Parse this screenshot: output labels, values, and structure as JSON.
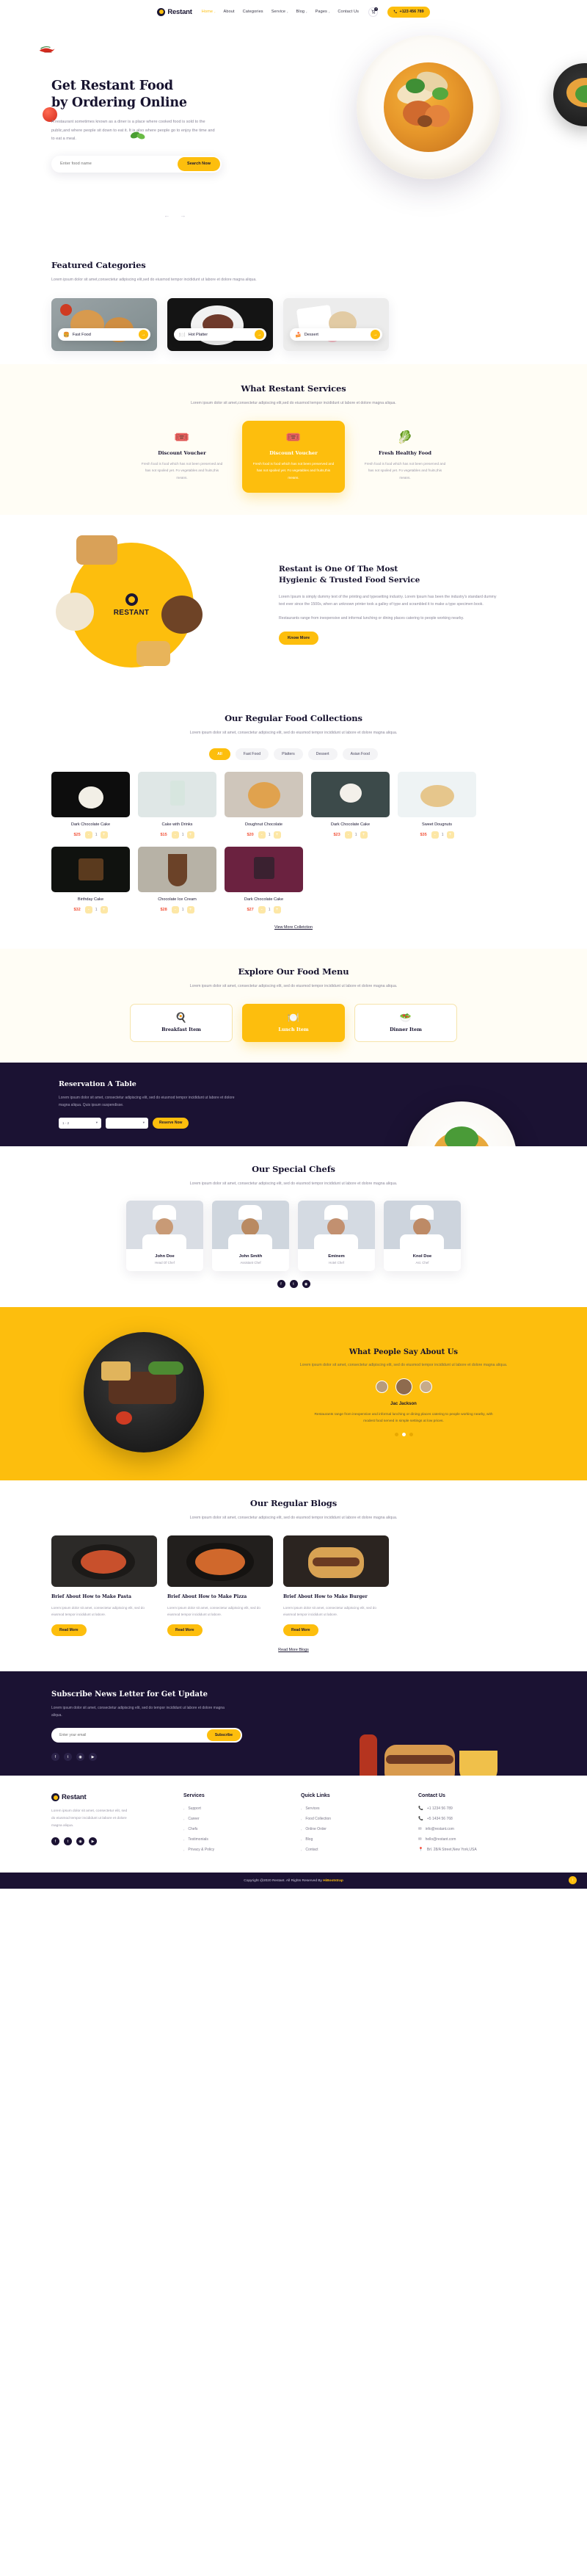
{
  "brand": {
    "name": "Restant",
    "logo_icon": "circle-logo-icon"
  },
  "header": {
    "nav": [
      {
        "label": "Home",
        "caret": "›",
        "active": true
      },
      {
        "label": "About",
        "caret": "",
        "active": false
      },
      {
        "label": "Categories",
        "caret": "",
        "active": false
      },
      {
        "label": "Service",
        "caret": "›",
        "active": false
      },
      {
        "label": "Blog",
        "caret": "›",
        "active": false
      },
      {
        "label": "Pages",
        "caret": "›",
        "active": false
      },
      {
        "label": "Contact Us",
        "caret": "",
        "active": false
      }
    ],
    "cart_icon": "shopping-cart-icon",
    "cart_count": "0",
    "phone_icon": "phone-icon",
    "phone": "+123 456 789"
  },
  "hero": {
    "title_line1": "Get Restant Food",
    "title_line2": "by Ordering Online",
    "paragraph": "A restaurant sometimes known as a diner is a place where cooked food is sold to the public,and where people sit down to eat it. It is also where people go to enjoy the time and to eat a meal.",
    "search_placeholder": "Enter food name",
    "search_button": "Search Now",
    "prev_icon": "arrow-left-icon",
    "next_icon": "arrow-right-icon"
  },
  "featured": {
    "title": "Featured Categories",
    "subtitle": "Lorem ipsum dolor sit amet,consectetur adipiscing elit,sed do eiusmod tempor incididunt ut labore et dolore magna aliqua.",
    "cards": [
      {
        "name": "Fast Food",
        "icon": "burger-icon",
        "go_icon": "arrow-right-icon"
      },
      {
        "name": "Hot Platter",
        "icon": "platter-icon",
        "go_icon": "arrow-right-icon"
      },
      {
        "name": "Dessert",
        "icon": "dessert-icon",
        "go_icon": "arrow-right-icon"
      }
    ]
  },
  "services": {
    "title": "What Restant Services",
    "subtitle": "Lorem ipsum dolor sit amet,consectetur adipiscing elit,sed do eiusmod tempor incididunt ut labore et dolore magna aliqua.",
    "cards": [
      {
        "icon": "voucher-icon",
        "title": "Discount Voucher",
        "text": "Fresh food is food which has not been preserved and has not spoiled yet. Fo vegetables and fruits,this means.",
        "active": false
      },
      {
        "icon": "voucher-icon",
        "title": "Discount Voucher",
        "text": "Fresh food is food which has not been preserved and has not spoiled yet. Fo vegetables and fruits,this means.",
        "active": true
      },
      {
        "icon": "vegetables-icon",
        "title": "Fresh Healthy Food",
        "text": "Fresh food is food which has not been preserved and has not spoiled yet. Fo vegetables and fruits,this means.",
        "active": false
      }
    ]
  },
  "hygienic": {
    "disc_label": "RESTANT",
    "title_line1": "Restant is One Of The Most",
    "title_line2": "Hygienic & Trusted Food Service",
    "paragraph1": "Lorem Ipsum is simply dummy text of the printing and typesetting industry. Lorem Ipsum has been the industry's standard dummy text ever since the 1500s, when an unknown printer took a galley of type and scrambled it to make a type specimen book.",
    "paragraph2": "Restaurants range from inexpensive and informal lunching or dining places catering to people working nearby.",
    "button": "Know More"
  },
  "collections": {
    "title": "Our Regular Food Collections",
    "subtitle": "Lorem ipsum dolor sit amet, consectetur adipiscing elit, sed do eiusmod tempor incididunt ut labore et dolore magna aliqua.",
    "tabs": [
      {
        "label": "All",
        "active": true
      },
      {
        "label": "Fast Food",
        "active": false
      },
      {
        "label": "Platters",
        "active": false
      },
      {
        "label": "Dessert",
        "active": false
      },
      {
        "label": "Asian Food",
        "active": false
      }
    ],
    "products": [
      {
        "name": "Dark Chocolate Cake",
        "price": "$25",
        "qty": "1",
        "minus": "-",
        "plus": "+"
      },
      {
        "name": "Cake with Drinks",
        "price": "$15",
        "qty": "1",
        "minus": "-",
        "plus": "+"
      },
      {
        "name": "Doughnut Chocolate",
        "price": "$20",
        "qty": "1",
        "minus": "-",
        "plus": "+"
      },
      {
        "name": "Dark Chocolate Cake",
        "price": "$23",
        "qty": "1",
        "minus": "-",
        "plus": "+"
      },
      {
        "name": "Sweet Dougnuts",
        "price": "$35",
        "qty": "1",
        "minus": "-",
        "plus": "+"
      },
      {
        "name": "Birthday Cake",
        "price": "$32",
        "qty": "1",
        "minus": "-",
        "plus": "+"
      },
      {
        "name": "Chocolate Ice Cream",
        "price": "$28",
        "qty": "1",
        "minus": "-",
        "plus": "+"
      },
      {
        "name": "Dark Chocolate Cake",
        "price": "$27",
        "qty": "1",
        "minus": "-",
        "plus": "+"
      }
    ],
    "view_more": "View More Colletction"
  },
  "foodmenu": {
    "title": "Explore Our Food Menu",
    "subtitle": "Lorem ipsum dolor sit amet, consectetur adipiscing elit, sed do eiusmod tempor incididunt ut labore et dolore magna aliqua.",
    "cards": [
      {
        "icon": "breakfast-icon",
        "label": "Breakfast Item",
        "active": false
      },
      {
        "icon": "lunch-icon",
        "label": "Lunch Item",
        "active": true
      },
      {
        "icon": "dinner-icon",
        "label": "Dinner Item",
        "active": false
      }
    ]
  },
  "reservation": {
    "title": "Reservation A Table",
    "paragraph": "Lorem ipsum dolor sit amet, consectetur adipiscing elit, sed do eiusmod tempor incididunt ut labore et dolore magna aliqua. Quis ipsum suspendisse.",
    "select_people": "1 - 2",
    "select_date": "",
    "button": "Reserve Now"
  },
  "chefs": {
    "title": "Our Special Chefs",
    "subtitle": "Lorem ipsum dolor sit amet, consectetur adipiscing elit, sed do eiusmod tempor incididunt ut labore et dolore magna aliqua.",
    "list": [
      {
        "name": "John Doe",
        "role": "Head Of Chef"
      },
      {
        "name": "John Smith",
        "role": "Assistant Chef"
      },
      {
        "name": "Eminem",
        "role": "Hotel Chef"
      },
      {
        "name": "Knol Doe",
        "role": "Ast. Chef"
      }
    ],
    "social": [
      {
        "icon": "facebook-icon"
      },
      {
        "icon": "twitter-icon"
      },
      {
        "icon": "instagram-icon"
      }
    ]
  },
  "testimonial": {
    "title": "What People Say About Us",
    "subtitle": "Lorem ipsum dolor sit amet, consectetur adipiscing elit, sed do eiusmod tempor incididunt ut labore et dolore magna aliqua.",
    "name": "Jac Jackson",
    "quote": "Restaurants range from inexpensive and informal lunching or dining places catering to people working nearby, with modest food served in simple settings at low prices."
  },
  "blogs": {
    "title": "Our Regular Blogs",
    "subtitle": "Lorem ipsum dolor sit amet, consectetur adipiscing elit, sed do eiusmod tempor incididunt ut labore et dolore magna aliqua.",
    "posts": [
      {
        "title": "Brief About How to Make Pasta",
        "text": "Lorem ipsum dolor sit amet, consectetur adipiscing elit, sed do eiusmod tempor incididunt ut labore.",
        "button": "Read More"
      },
      {
        "title": "Brief About How to Make Pizza",
        "text": "Lorem ipsum dolor sit amet, consectetur adipiscing elit, sed do eiusmod tempor incididunt ut labore.",
        "button": "Read More"
      },
      {
        "title": "Brief About How to Make Burger",
        "text": "Lorem ipsum dolor sit amet, consectetur adipiscing elit, sed do eiusmod tempor incididunt ut labore.",
        "button": "Read More"
      }
    ],
    "read_more": "Read More Blogs"
  },
  "newsletter": {
    "title": "Subscribe News Letter for Get Update",
    "paragraph": "Lorem ipsum dolor sit amet, consectetur adipiscing elit, sed do tempor incididunt ut labore et dolore magna aliqua.",
    "placeholder": "Enter your email",
    "button": "Subscribe",
    "social": [
      {
        "icon": "facebook-icon"
      },
      {
        "icon": "twitter-icon"
      },
      {
        "icon": "instagram-icon"
      },
      {
        "icon": "youtube-icon"
      }
    ]
  },
  "footer": {
    "about": "Lorem ipsum dolor sit amet, consectetur elit, sed do eiusmod tempor incididunt ut labore et dolore magna aliqua.",
    "social": [
      {
        "icon": "facebook-icon"
      },
      {
        "icon": "twitter-icon"
      },
      {
        "icon": "instagram-icon"
      },
      {
        "icon": "youtube-icon"
      }
    ],
    "services": {
      "title": "Services",
      "items": [
        "Support",
        "Career",
        "Chefs",
        "Testimonials",
        "Privacy & Policy"
      ]
    },
    "quick_links": {
      "title": "Quick Links",
      "items": [
        "Services",
        "Food Collection",
        "Online Order",
        "Blog",
        "Contact"
      ]
    },
    "contact": {
      "title": "Contact Us",
      "items": [
        {
          "icon": "phone-icon",
          "text": "+1 1234 56 789"
        },
        {
          "icon": "phone-icon",
          "text": "+5 1434 56 768"
        },
        {
          "icon": "mail-icon",
          "text": "info@restant.com"
        },
        {
          "icon": "mail-icon",
          "text": "hello@restant.com"
        },
        {
          "icon": "location-icon",
          "text": "Brl. 28/A Street,New York,USA"
        }
      ]
    },
    "copyright_prefix": "Copyright @2020 Restant. All Rights Reserved By ",
    "copyright_brand": "HiBootstrap",
    "to_top_icon": "arrow-up-icon"
  }
}
